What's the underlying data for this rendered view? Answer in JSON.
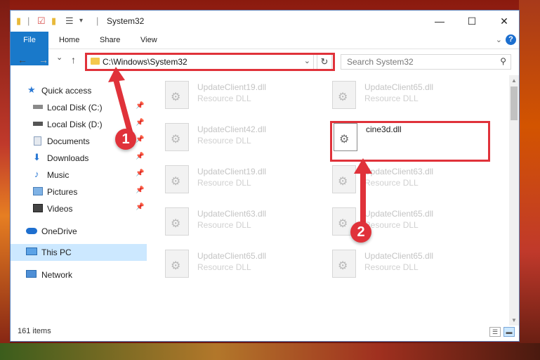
{
  "window": {
    "title": "System32"
  },
  "ribbon": {
    "tabs": [
      "File",
      "Home",
      "Share",
      "View"
    ],
    "help": "?"
  },
  "navbar": {
    "back": "←",
    "forward": "→",
    "recent": "⌄",
    "up": "↑",
    "refresh": "↻"
  },
  "address": {
    "path": "C:\\Windows\\System32"
  },
  "search": {
    "placeholder": "Search System32"
  },
  "sidebar": {
    "items": [
      {
        "label": "Quick access",
        "icon": "star-icon"
      },
      {
        "label": "Local Disk (C:)",
        "icon": "drive-icon",
        "pinned": true
      },
      {
        "label": "Local Disk (D:)",
        "icon": "drive-icon",
        "pinned": true
      },
      {
        "label": "Documents",
        "icon": "documents-icon",
        "pinned": true
      },
      {
        "label": "Downloads",
        "icon": "download-icon",
        "pinned": true
      },
      {
        "label": "Music",
        "icon": "music-icon",
        "pinned": true
      },
      {
        "label": "Pictures",
        "icon": "pictures-icon",
        "pinned": true
      },
      {
        "label": "Videos",
        "icon": "videos-icon",
        "pinned": true
      },
      {
        "label": "OneDrive",
        "icon": "cloud-icon"
      },
      {
        "label": "This PC",
        "icon": "computer-icon",
        "selected": true
      },
      {
        "label": "Network",
        "icon": "network-icon"
      }
    ]
  },
  "files": [
    {
      "name": "UpdateClient19.dll",
      "type": "Resource DLL"
    },
    {
      "name": "UpdateClient65.dll",
      "type": "Resource DLL"
    },
    {
      "name": "UpdateClient42.dll",
      "type": "Resource DLL"
    },
    {
      "name": "cine3d.dll",
      "type": ""
    },
    {
      "name": "UpdateClient19.dll",
      "type": "Resource DLL"
    },
    {
      "name": "UpdateClient63.dll",
      "type": "Resource DLL"
    },
    {
      "name": "UpdateClient63.dll",
      "type": "Resource DLL"
    },
    {
      "name": "UpdateClient65.dll",
      "type": "Resource DLL"
    },
    {
      "name": "UpdateClient65.dll",
      "type": "Resource DLL"
    },
    {
      "name": "UpdateClient65.dll",
      "type": "Resource DLL"
    }
  ],
  "status": {
    "count": "161 items"
  },
  "annotations": {
    "step1": "1",
    "step2": "2",
    "color": "#e0323a"
  }
}
